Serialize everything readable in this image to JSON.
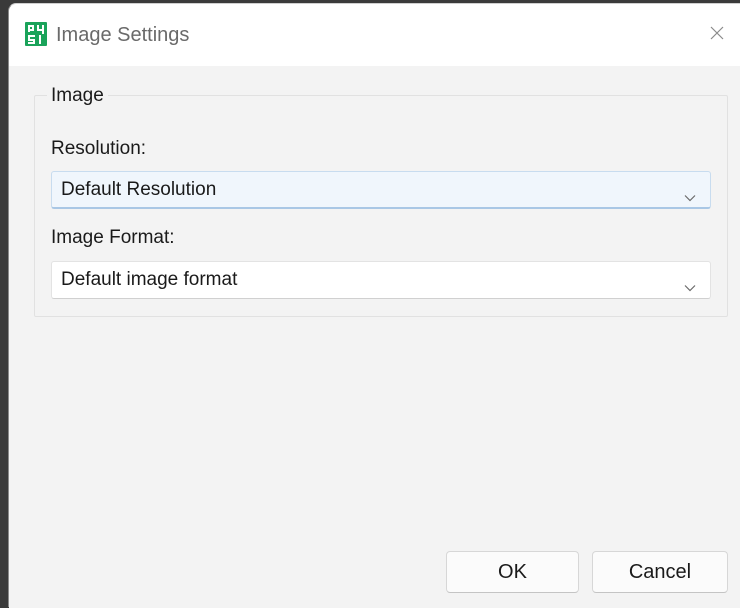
{
  "window": {
    "title": "Image Settings",
    "app_icon": "app-logo-icon",
    "close_icon": "close-icon"
  },
  "group": {
    "title": "Image"
  },
  "resolution": {
    "label": "Resolution:",
    "selected": "Default Resolution"
  },
  "image_format": {
    "label": "Image Format:",
    "selected": "Default image format"
  },
  "buttons": {
    "ok_label": "OK",
    "cancel_label": "Cancel"
  },
  "colors": {
    "app_icon_green": "#1aa35a",
    "focus_bg": "#f0f6fc",
    "window_bg": "#f3f3f3"
  }
}
